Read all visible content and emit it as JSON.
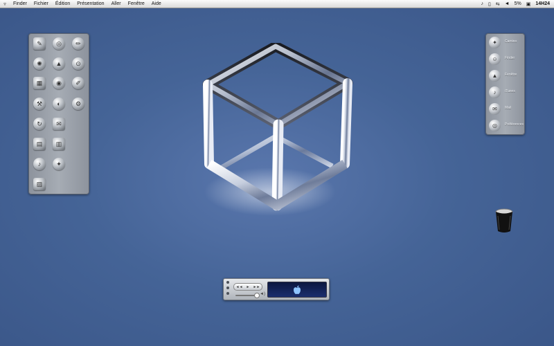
{
  "menubar": {
    "items": [
      "Finder",
      "Fichier",
      "Édition",
      "Présentation",
      "Aller",
      "Fenêtre",
      "Aide"
    ],
    "battery": "5%",
    "clock": "14H24"
  },
  "dock_right": {
    "items": [
      {
        "label": "Camino",
        "icon": "compass-icon"
      },
      {
        "label": "Finder",
        "icon": "finder-icon"
      },
      {
        "label": "Fenêtre",
        "icon": "rocket-icon"
      },
      {
        "label": "iTunes",
        "icon": "music-note-icon"
      },
      {
        "label": "Mail",
        "icon": "mail-icon"
      },
      {
        "label": "Préférences",
        "icon": "globe-icon"
      }
    ]
  },
  "dock_left": {
    "icons": [
      "wrench-tool-icon",
      "globe-icon",
      "gear-icon",
      "rocket-icon",
      "magnifier-icon",
      "calculator-icon",
      "network-icon",
      "pen-icon",
      "tools-icon",
      "satellite-icon",
      "terminal-icon",
      "refresh-icon",
      "mail-icon",
      "printer-icon",
      "folder-icon",
      "music-note-icon",
      "compass-icon",
      "disk-icon"
    ]
  },
  "colors": {
    "desktop": "#456497",
    "panel": "#9aa0a8",
    "player_screen": "#0c1740"
  }
}
